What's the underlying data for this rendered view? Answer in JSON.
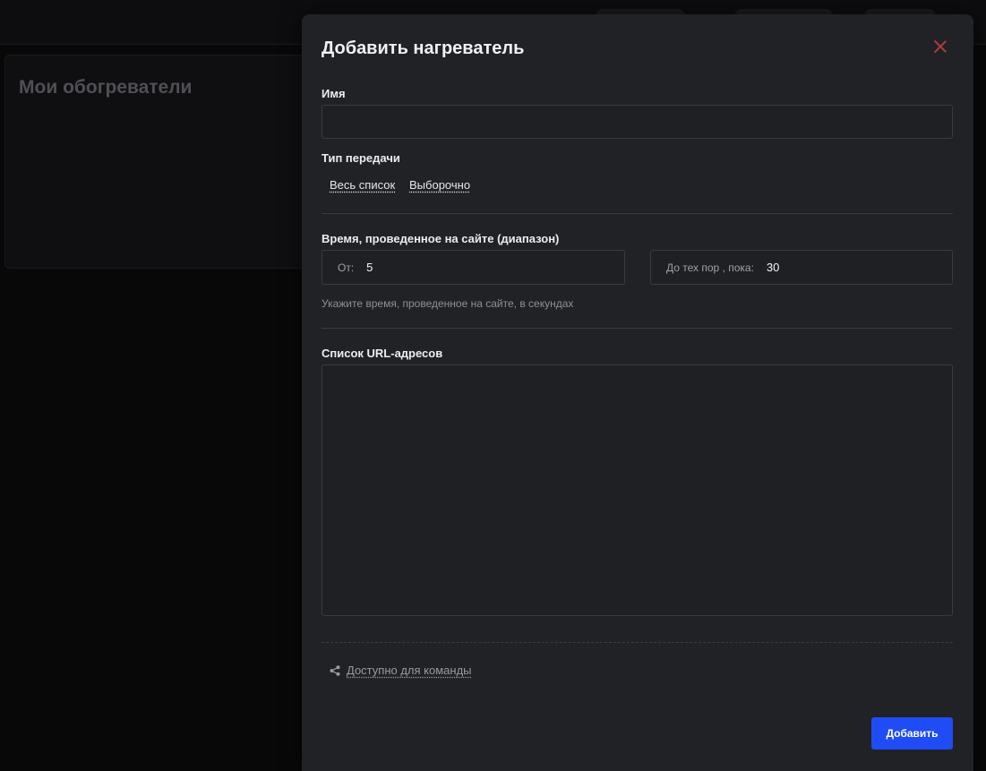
{
  "background": {
    "card_title": "Мои обогреватели"
  },
  "modal": {
    "title": "Добавить нагреватель",
    "name_label": "Имя",
    "name_value": "",
    "transfer_type_label": "Тип передачи",
    "transfer_options": [
      "Весь список",
      "Выборочно"
    ],
    "time_label": "Время, проведенное на сайте (диапазон)",
    "from_prefix": "От:",
    "from_value": "5",
    "to_prefix": "До тех пор , пока:",
    "to_value": "30",
    "time_hint": "Укажите время, проведенное на сайте, в секундах",
    "urls_label": "Список URL-адресов",
    "urls_value": "",
    "team_label": "Доступно для команды",
    "submit_label": "Добавить"
  },
  "colors": {
    "accent": "#1f4cf5",
    "close": "#b23b3b",
    "modal_bg": "#212225"
  },
  "icons": {
    "close": "close-icon",
    "share": "share-icon"
  }
}
